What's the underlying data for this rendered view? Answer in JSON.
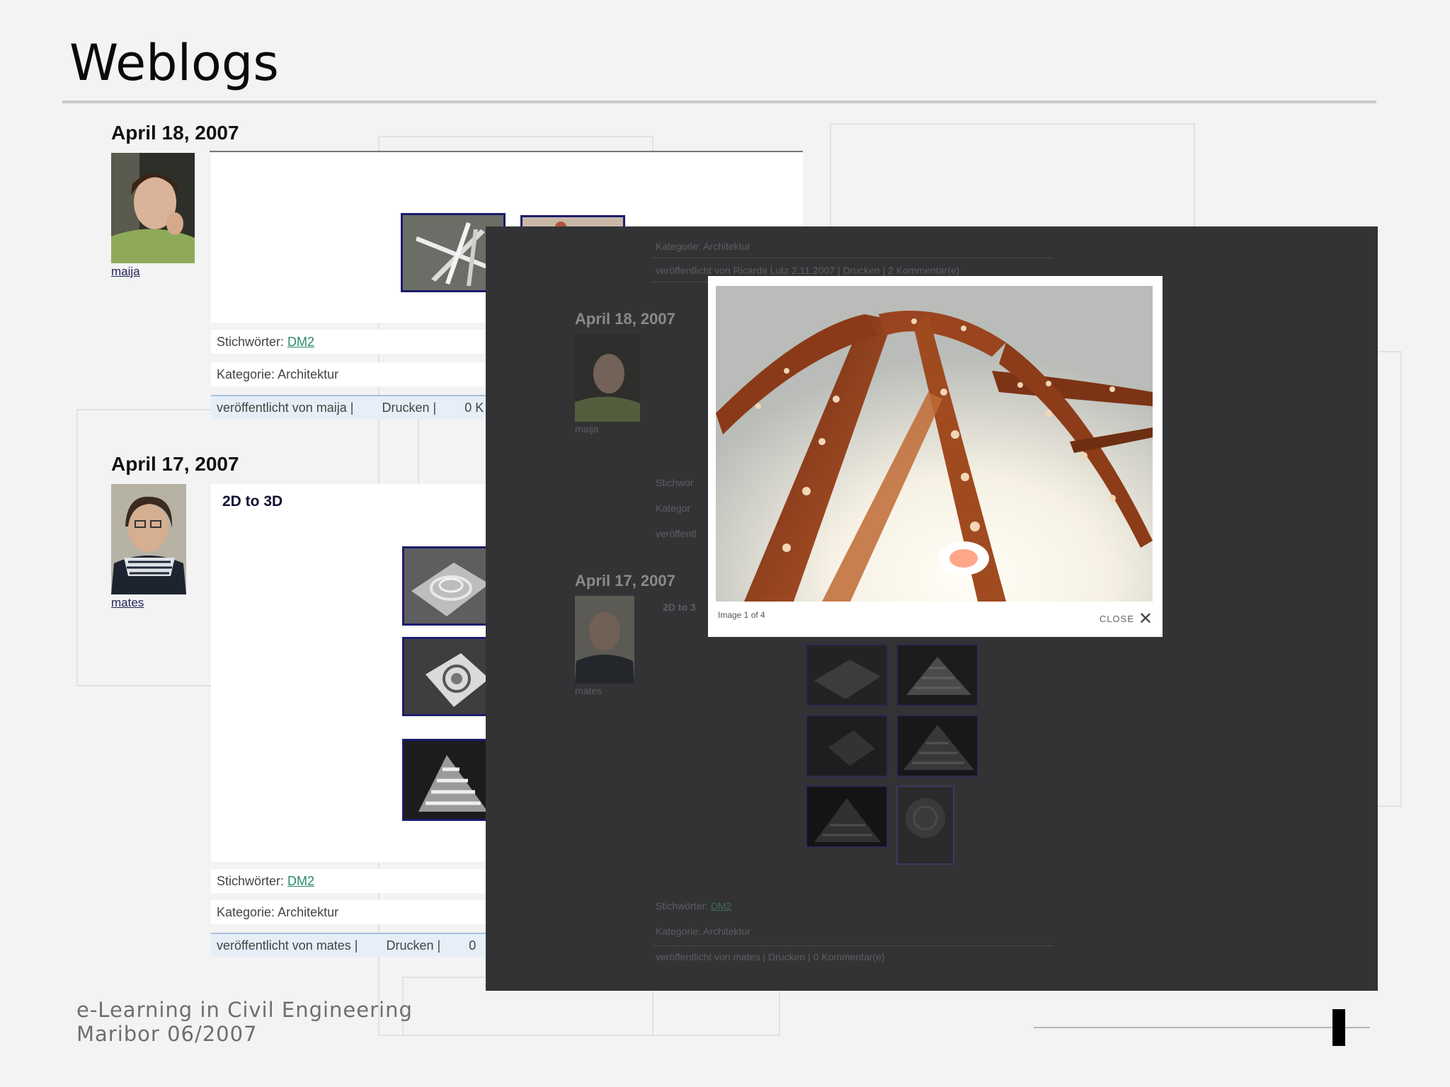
{
  "slide": {
    "title": "Weblogs",
    "footer": {
      "line1": "e-Learning in Civil Engineering",
      "line2": "Maribor 06/2007"
    }
  },
  "blog": {
    "posts": [
      {
        "date": "April 18, 2007",
        "author": "maija",
        "keywords_label": "Stichwörter:",
        "keywords_link": "DM2",
        "category": "Kategorie: Architektur",
        "published_by": "veröffentlicht von maija |",
        "print_label": "Drucken |",
        "comments_count": "0 K"
      },
      {
        "date": "April 17, 2007",
        "author": "mates",
        "title": "2D to 3D",
        "keywords_label": "Stichwörter:",
        "keywords_link": "DM2",
        "category": "Kategorie: Architektur",
        "published_by": "veröffentlicht von mates |",
        "print_label": "Drucken |",
        "comments_count": "0"
      }
    ]
  },
  "overlay_page": {
    "top_category": "Kategorie: Architektur",
    "top_published": "veröffentlicht von Ricarda Lutz 2.11.2007 | Drucken | 2 Kommentar(e)",
    "post1_date": "April 18, 2007",
    "post1_author": "maija",
    "post1_kw": "Stichwör",
    "post1_cat": "Kategor",
    "post1_pub": "veröffentl",
    "post2_date": "April 17, 2007",
    "post2_author": "mates",
    "post2_title": "2D to 3",
    "post2_kw_label": "Stichwörter:",
    "post2_kw_link": "DM2",
    "post2_cat": "Kategorie: Architektur",
    "post2_pub": "veröffentlicht von mates | Drucken | 0 Kommentar(e)"
  },
  "lightbox": {
    "caption": "Image 1 of 4",
    "close_label": "CLOSE",
    "close_icon": "close-icon"
  }
}
